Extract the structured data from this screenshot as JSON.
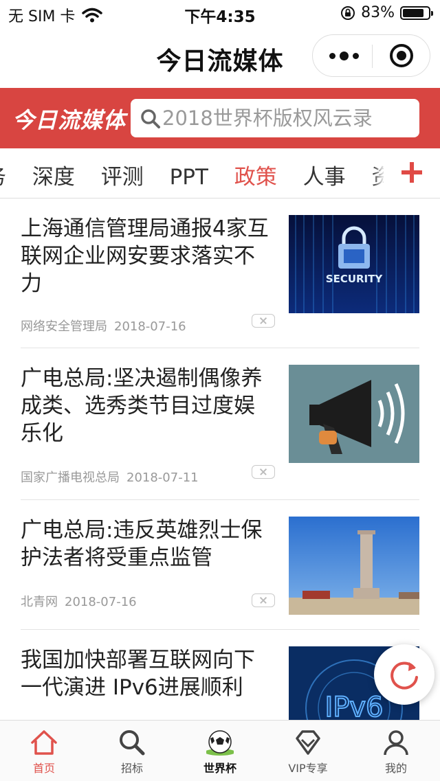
{
  "status_bar": {
    "carrier": "无 SIM 卡",
    "time": "下午4:35",
    "battery": "83%",
    "battery_level": 0.83
  },
  "app": {
    "title": "今日流媒体",
    "menu_icon": "more-dots-icon",
    "close_icon": "target-icon"
  },
  "header": {
    "logo": "今日流媒体",
    "search_placeholder": "2018世界杯版权风云录",
    "accent": "#d84541"
  },
  "tabs": {
    "items": [
      "务",
      "深度",
      "评测",
      "PPT",
      "政策",
      "人事",
      "资本"
    ],
    "active_index": 4,
    "active_color": "#e0524c"
  },
  "news": [
    {
      "title": "上海通信管理局通报4家互联网企业网安要求落实不力",
      "source": "网络安全管理局",
      "date": "2018-07-16",
      "thumb": "SECURITY"
    },
    {
      "title": "广电总局:坚决遏制偶像养成类、选秀类节目过度娱乐化",
      "source": "国家广播电视总局",
      "date": "2018-07-11",
      "thumb": ""
    },
    {
      "title": "广电总局:违反英雄烈士保护法者将受重点监管",
      "source": "北青网",
      "date": "2018-07-16",
      "thumb": ""
    },
    {
      "title": "我国加快部署互联网向下一代演进 IPv6进展顺利",
      "source": "",
      "date": "",
      "thumb": "IPv6"
    }
  ],
  "tabbar": {
    "items": [
      "首页",
      "招标",
      "世界杯",
      "VIP专享",
      "我的"
    ],
    "active_index": 0
  }
}
